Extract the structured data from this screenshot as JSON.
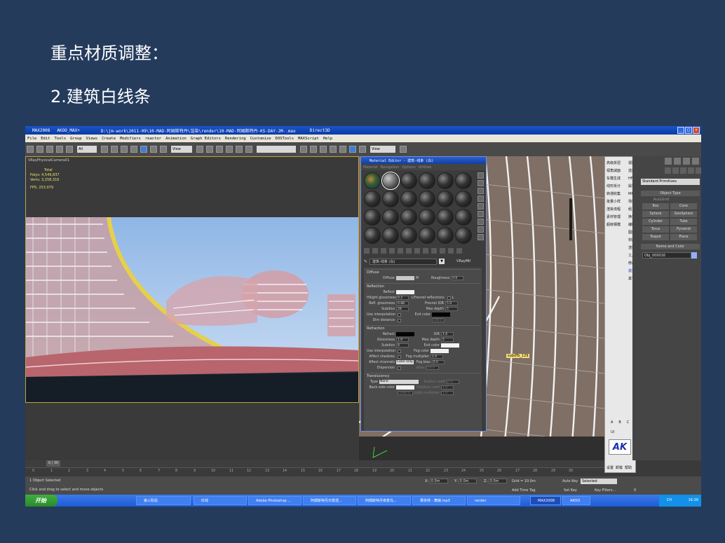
{
  "slide": {
    "title": "重点材质调整：",
    "subtitle": "2.建筑白线条"
  },
  "window": {
    "app": "MAX2008",
    "user": "AKOO_MAX+",
    "path": "D:\\jm-work\\2011-09\\10-MAD-阿姆斯特丹\\渲染\\render\\10-MAD-阿姆斯特丹-KS-DAY-JM-.max",
    "renderer": "Direct3D"
  },
  "menu": [
    "File",
    "Edit",
    "Tools",
    "Group",
    "Views",
    "Create",
    "Modifiers",
    "reactor",
    "Animation",
    "Graph Editors",
    "Rendering",
    "Customize",
    "DOSTools",
    "MAXScript",
    "Help"
  ],
  "toolbar": {
    "selection_filter": "All",
    "ref_coord": "View",
    "ref_coord2": "View"
  },
  "viewport_left": {
    "label": "VRayPhysicalCamera01",
    "stats": {
      "total": "Total",
      "polys": "Polys:    4,549,837",
      "verts": "Verts:    3,258,316",
      "fps": "FPS:     253.079"
    }
  },
  "viewport_right": {
    "object_tag": "subdTo_129"
  },
  "material_editor": {
    "title": "Material Editor - 建筑-线条 (白)",
    "menu": [
      "Material",
      "Navigation",
      "Options",
      "Utilities"
    ],
    "material_name": "建筑-线条 (白)",
    "material_type": "VRayMtl",
    "diffuse": {
      "header": "Diffuse",
      "diffuse_label": "Diffuse",
      "map_btn": "M",
      "roughness_label": "Roughness",
      "roughness": "0.0"
    },
    "reflection": {
      "header": "Reflection",
      "reflect_label": "Reflect",
      "hilight_label": "Hilight glossiness",
      "hilight": "0.2",
      "lock": "L",
      "fresnel_label": "Fresnel reflections",
      "fresnel_lock": "L",
      "refl_gloss_label": "Refl. glossiness",
      "refl_gloss": "0.88",
      "fresnel_ior_label": "Fresnel IOR",
      "fresnel_ior": "5.0",
      "subdivs_label": "Subdivs",
      "subdivs": "28",
      "max_depth_label": "Max depth",
      "max_depth": "5",
      "use_interp_label": "Use interpolation",
      "exit_color_label": "Exit color",
      "dim_dist_label": "Dim distance",
      "dim_dist": "100.0"
    },
    "refraction": {
      "header": "Refraction",
      "refract_label": "Refract",
      "ior_label": "IOR",
      "ior": "1.6",
      "gloss_label": "Glossiness",
      "gloss": "1.0",
      "max_depth_label": "Max depth",
      "max_depth": "5",
      "subdivs_label": "Subdivs",
      "subdivs": "8",
      "exit_color_label": "Exit color",
      "use_interp_label": "Use interpolation",
      "fog_color_label": "Fog color",
      "affect_shadows_label": "Affect shadows",
      "fog_mult_label": "Fog multiplier",
      "fog_mult": "1.0",
      "affect_channels_label": "Affect channels",
      "affect_channels": "Color only",
      "fog_bias_label": "Fog bias",
      "fog_bias": "0.0",
      "dispersion_label": "Dispersion",
      "abbe_label": "Abbe",
      "abbe": "50.0"
    },
    "translucency": {
      "header": "Translucency",
      "type_label": "Type",
      "type": "None",
      "scatter_label": "Scatter coeff",
      "scatter": "0.0",
      "back_side_label": "Back-side color",
      "fwd_bck_label": "Fwd/bck coeff",
      "fwd_bck": "1.0",
      "thickness": "1000.0",
      "light_mult_label": "Light multiplier",
      "light_mult": "1.0"
    }
  },
  "command_panel": {
    "primitives": "Standard Primitives",
    "object_type_header": "Object Type",
    "autogrid": "AutoGrid",
    "objects": [
      "Box",
      "Cone",
      "Sphere",
      "GeoSphere",
      "Cylinder",
      "Tube",
      "Torus",
      "Pyramid",
      "Teapot",
      "Plane"
    ],
    "name_color_header": "Name and Color",
    "object_name": "Obj_000016"
  },
  "cn_panel": {
    "items": [
      "高级拆扭",
      "视角减面",
      "车模生成",
      "线形拆分",
      "转通收集",
      "批量小样",
      "渲染流程",
      "素材管理",
      "超级钢模"
    ],
    "right_items": [
      "视图",
      "选择",
      "HFI",
      "属性",
      "MRS",
      "场地",
      "组",
      "换案",
      "编码",
      "图形",
      "材质",
      "渲理",
      "工具",
      "修改",
      "其它"
    ],
    "selected_right": "激活",
    "abc": [
      "A",
      "B",
      "C"
    ],
    "ui": "UI",
    "bottom": [
      "设置",
      "卸载",
      "帮助"
    ]
  },
  "timeline": {
    "frame": "0 / 30",
    "ticks": [
      "0",
      "1",
      "2",
      "3",
      "4",
      "5",
      "6",
      "7",
      "8",
      "9",
      "10",
      "11",
      "12",
      "13",
      "14",
      "15",
      "16",
      "17",
      "18",
      "19",
      "20",
      "21",
      "22",
      "23",
      "24",
      "25",
      "26",
      "27",
      "28",
      "29",
      "30"
    ]
  },
  "status": {
    "selected": "1 Object Selected",
    "hint": "Click and drag to select and move objects",
    "x": "0.0m",
    "y": "0.0m",
    "z": "0.0m",
    "grid": "Grid = 10.0m",
    "auto_key": "Auto Key",
    "set_key": "Set Key",
    "selected_dropdown": "Selected",
    "key_filters": "Key Filters...",
    "add_time_tag": "Add Time Tag",
    "frame_no": "0"
  },
  "taskbar": {
    "start": "开始",
    "tasks": [
      "第三阶段",
      "红线",
      "Adobe Photoshop ...",
      "阿姆斯特丹日景透...",
      "阿姆斯特丹夜景鸟...",
      "果依林 - 舞娘.mp3",
      "render",
      "MAX2008",
      "AKOO"
    ],
    "clock": "16:39",
    "lang": "CH"
  }
}
